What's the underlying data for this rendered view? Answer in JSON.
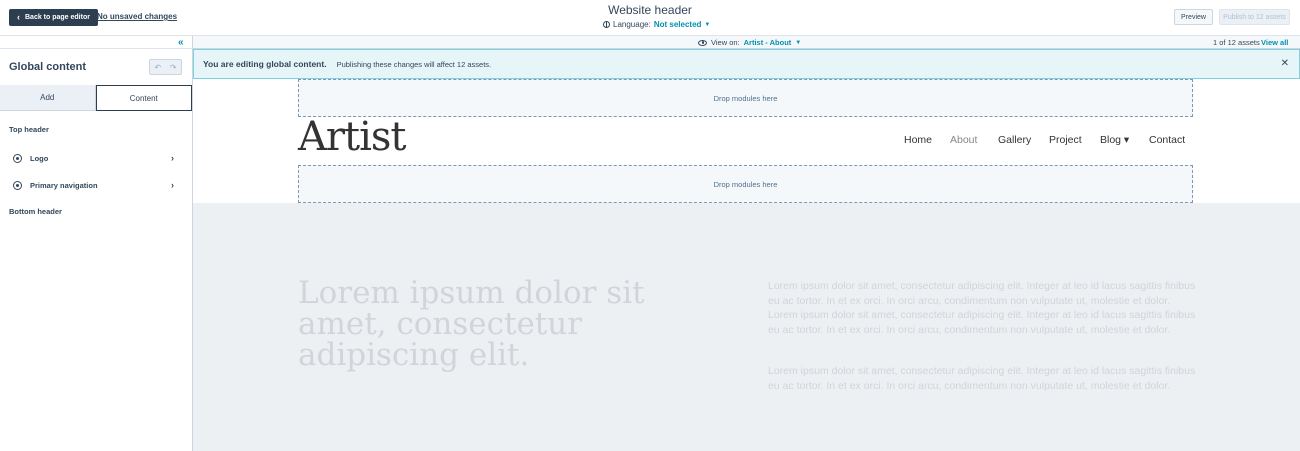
{
  "topbar": {
    "back_label": "Back to page editor",
    "unsaved_label": "No unsaved changes",
    "title": "Website header",
    "language_label": "Language:",
    "language_value": "Not selected",
    "preview_label": "Preview",
    "publish_label": "Publish to 12 assets"
  },
  "sidebar": {
    "title": "Global content",
    "tabs": [
      {
        "label": "Add",
        "active": false
      },
      {
        "label": "Content",
        "active": true
      }
    ],
    "sections": [
      {
        "label": "Top header",
        "items": [
          {
            "label": "Logo",
            "icon": "logo-icon"
          },
          {
            "label": "Primary navigation",
            "icon": "navigation-icon"
          }
        ]
      },
      {
        "label": "Bottom header",
        "items": []
      }
    ]
  },
  "viewbar": {
    "view_on_label": "View on:",
    "view_on_value": "Artist - About",
    "assets_count": "1 of 12 assets",
    "view_all_label": "View all"
  },
  "banner": {
    "bold_text": "You are editing global content.",
    "text": "Publishing these changes will affect 12 assets."
  },
  "preview": {
    "drop_label": "Drop modules here",
    "logo_text": "Artist",
    "nav_items": [
      "Home",
      "About",
      "Gallery",
      "Project",
      "Blog ▾",
      "Contact"
    ],
    "headline": "Lorem ipsum dolor sit amet, consectetur adipiscing elit.",
    "paragraphs": [
      "Lorem ipsum dolor sit amet, consectetur adipiscing elit. Integer at leo id lacus sagittis finibus eu ac tortor. In et ex orci. In orci arcu, condimentum non vulputate ut, molestie et dolor. Lorem ipsum dolor sit amet, consectetur adipiscing elit. Integer at leo id lacus sagittis finibus eu ac tortor. In et ex orci. In orci arcu, condimentum non vulputate ut, molestie et dolor.",
      "Lorem ipsum dolor sit amet, consectetur adipiscing elit. Integer at leo id lacus sagittis finibus eu ac tortor. In et ex orci. In orci arcu, condimentum non vulputate ut, molestie et dolor."
    ]
  },
  "colors": {
    "accent": "#0091ae",
    "dark_button": "#2d3e50",
    "banner_bg": "#e5f5f8"
  }
}
